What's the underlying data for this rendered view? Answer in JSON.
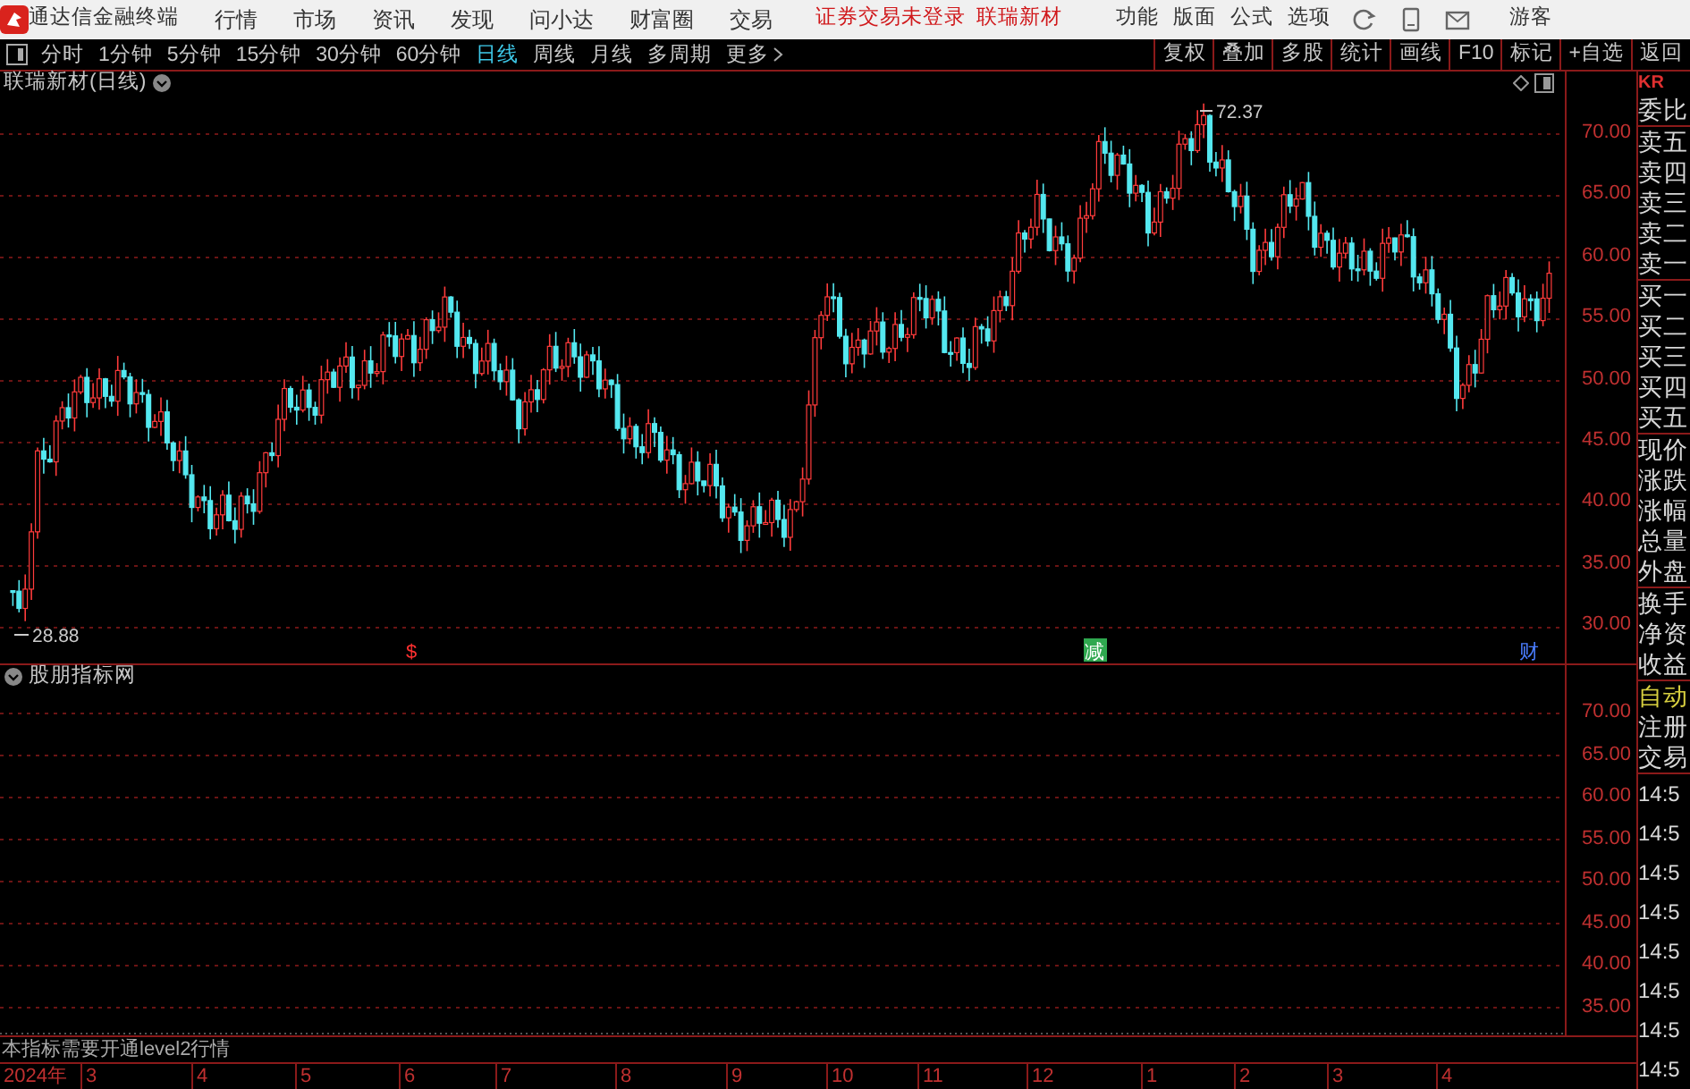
{
  "app": {
    "title": "通达信金融终端"
  },
  "menu": [
    "行情",
    "市场",
    "资讯",
    "发现",
    "问小达",
    "财富圈",
    "交易"
  ],
  "login_notice": "证券交易未登录",
  "stock_name": "联瑞新材",
  "tools": [
    "功能",
    "版面",
    "公式",
    "选项"
  ],
  "user": "游客",
  "periods": [
    {
      "label": "分时",
      "selected": false
    },
    {
      "label": "1分钟",
      "selected": false
    },
    {
      "label": "5分钟",
      "selected": false
    },
    {
      "label": "15分钟",
      "selected": false
    },
    {
      "label": "30分钟",
      "selected": false
    },
    {
      "label": "60分钟",
      "selected": false
    },
    {
      "label": "日线",
      "selected": true
    },
    {
      "label": "周线",
      "selected": false
    },
    {
      "label": "月线",
      "selected": false
    },
    {
      "label": "多周期",
      "selected": false
    },
    {
      "label": "更多",
      "selected": false
    }
  ],
  "actions": [
    "复权",
    "叠加",
    "多股",
    "统计",
    "画线",
    "F10",
    "标记",
    "+自选",
    "返回"
  ],
  "main_chart": {
    "title": "联瑞新材(日线)",
    "yticks": [
      "70.00",
      "65.00",
      "60.00",
      "55.00",
      "50.00",
      "45.00",
      "40.00",
      "35.00",
      "30.00"
    ],
    "high": "72.37",
    "low": "28.88",
    "events": [
      {
        "label": "$",
        "color": "#ff3030"
      },
      {
        "label": "减",
        "color": "#2fa84f"
      },
      {
        "label": "财",
        "color": "#4a7dff"
      }
    ]
  },
  "indicator": {
    "title": "股朋指标网",
    "yticks": [
      "70.00",
      "65.00",
      "60.00",
      "55.00",
      "50.00",
      "45.00",
      "40.00",
      "35.00"
    ],
    "notice": "本指标需要开通level2行情"
  },
  "time_axis": [
    "2024年",
    "3",
    "4",
    "5",
    "6",
    "7",
    "8",
    "9",
    "10",
    "11",
    "12",
    "1",
    "2",
    "3",
    "4"
  ],
  "side_panel": {
    "header": "KR",
    "quote_groups": [
      [
        "委比"
      ],
      [
        "卖五",
        "卖四",
        "卖三",
        "卖二",
        "卖一"
      ],
      [
        "买一",
        "买二",
        "买三",
        "买四",
        "买五"
      ],
      [
        "现价",
        "涨跌",
        "涨幅",
        "总量",
        "外盘"
      ],
      [
        "换手",
        "净资",
        "收益"
      ]
    ],
    "links": [
      {
        "label": "自动",
        "kind": "auto"
      },
      {
        "label": "注册",
        "kind": "plain"
      },
      {
        "label": "交易",
        "kind": "plain"
      }
    ],
    "times": [
      "14:5",
      "14:5",
      "14:5",
      "14:5",
      "14:5",
      "14:5",
      "14:5",
      "14:5"
    ]
  }
}
